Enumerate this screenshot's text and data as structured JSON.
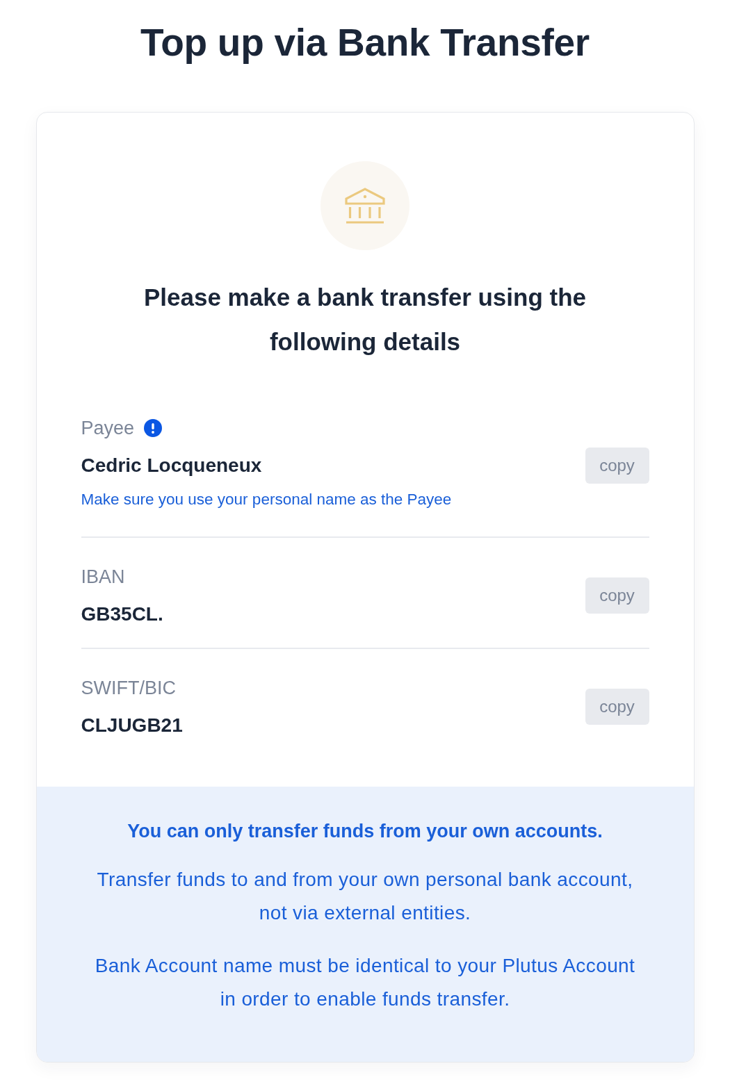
{
  "title": "Top up via Bank Transfer",
  "card": {
    "heading": "Please make a bank transfer using the following details",
    "fields": [
      {
        "label": "Payee",
        "info": true,
        "value": "Cedric Locqueneux",
        "note": "Make sure you use your personal name as the Payee",
        "copy_button": "copy"
      },
      {
        "label": "IBAN",
        "info": false,
        "value": "GB35CL.",
        "copy_button": "copy"
      },
      {
        "label": "SWIFT/BIC",
        "info": false,
        "value": "CLJUGB21",
        "copy_button": "copy"
      }
    ],
    "notice": {
      "title": "You can only transfer funds from your own accounts.",
      "paragraphs": [
        "Transfer funds to and from your own personal bank account, not via external entities.",
        "Bank Account name must be identical to your Plutus Account in order to enable funds transfer."
      ]
    }
  }
}
